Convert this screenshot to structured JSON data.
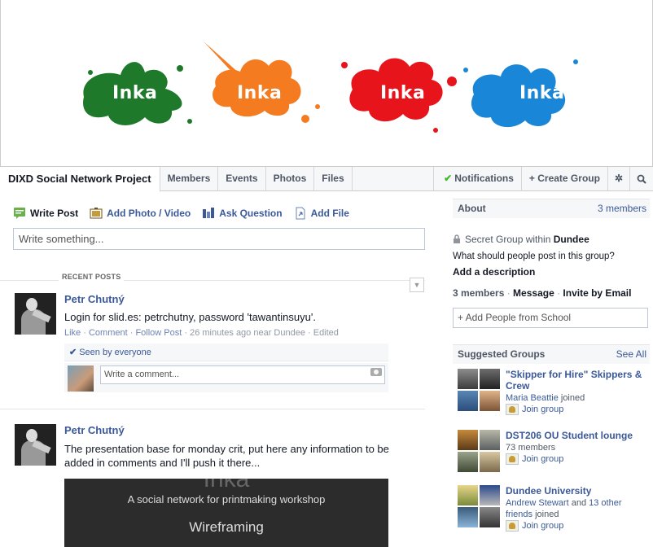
{
  "cover": {
    "splats": [
      "Inka",
      "Inka",
      "Inka",
      "Inka"
    ],
    "colors": [
      "#1e7a2a",
      "#f47b20",
      "#e8141b",
      "#1a86d8"
    ]
  },
  "tabs": {
    "group_name": "DIXD Social Network Project",
    "items": [
      "Members",
      "Events",
      "Photos",
      "Files"
    ],
    "notifications": "Notifications",
    "create_group": "+ Create Group"
  },
  "composer": {
    "write_post": "Write Post",
    "add_photo": "Add Photo / Video",
    "ask_question": "Ask Question",
    "add_file": "Add File",
    "placeholder": "Write something..."
  },
  "feed": {
    "recent_posts": "RECENT POSTS",
    "posts": [
      {
        "author": "Petr Chutný",
        "text": "Login for slid.es: petrchutny, password 'tawantinsuyu'.",
        "like": "Like",
        "comment": "Comment",
        "follow": "Follow Post",
        "meta": "26 minutes ago near Dundee · Edited",
        "seen": "Seen by everyone",
        "comment_placeholder": "Write a comment..."
      },
      {
        "author": "Petr Chutný",
        "text": "The presentation base for monday crit, put here any information to be added in comments and I'll push it there...",
        "slide_big": "Inka",
        "slide_sub": "A social network for printmaking workshop",
        "slide_title": "Wireframing"
      }
    ]
  },
  "about": {
    "title": "About",
    "members_link": "3 members",
    "secret": "Secret Group within",
    "place": "Dundee",
    "question": "What should people post in this group?",
    "add_description": "Add a description",
    "members": "3 members",
    "message": "Message",
    "invite": "Invite by Email",
    "add_people": "+ Add People from School"
  },
  "suggested": {
    "title": "Suggested Groups",
    "see_all": "See All",
    "join": "Join group",
    "groups": [
      {
        "name": "\"Skipper for Hire\" Skippers & Crew",
        "sub_link": "Maria Beattie",
        "sub_rest": " joined"
      },
      {
        "name": "DST206 OU Student lounge",
        "sub_link": "",
        "sub_rest": "73 members"
      },
      {
        "name": "Dundee University",
        "sub_link": "Andrew Stewart",
        "sub_rest": " and ",
        "sub_link2": "13 other friends",
        "sub_rest2": " joined"
      }
    ]
  }
}
